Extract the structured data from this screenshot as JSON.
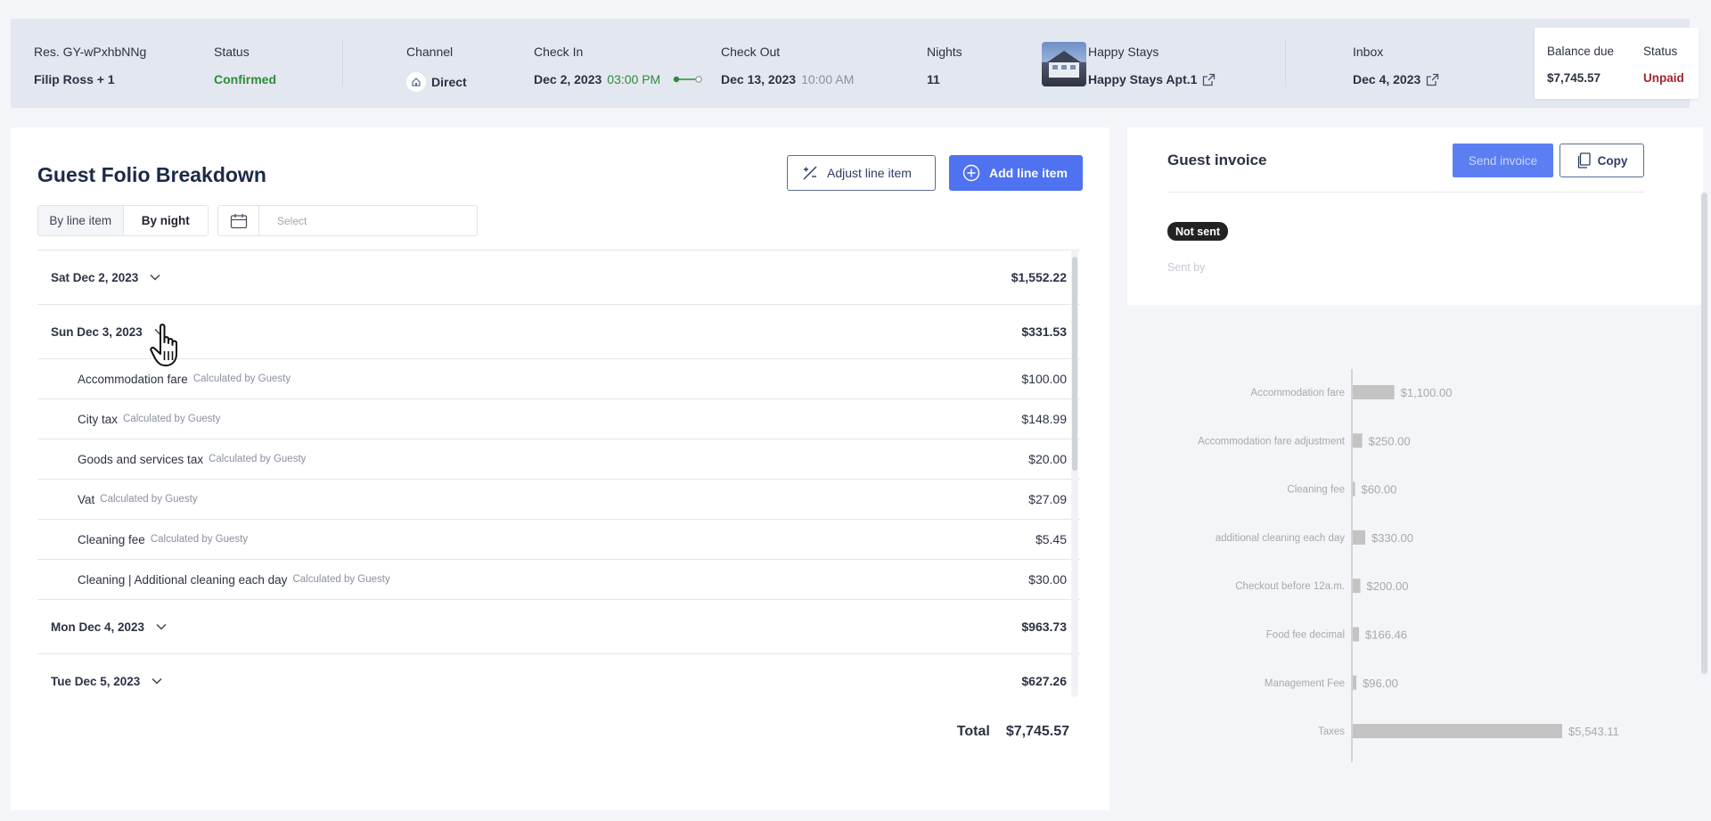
{
  "reservation": {
    "res_label": "Res. GY-wPxhbNNg",
    "guest": "Filip Ross + 1",
    "status_label": "Status",
    "status_value": "Confirmed",
    "channel_label": "Channel",
    "channel_value": "Direct",
    "checkin_label": "Check In",
    "checkin_date": "Dec 2, 2023",
    "checkin_time": "03:00 PM",
    "checkout_label": "Check Out",
    "checkout_date": "Dec 13, 2023",
    "checkout_time": "10:00 AM",
    "nights_label": "Nights",
    "nights_value": "11",
    "listing_label": "Happy Stays",
    "listing_value": "Happy Stays Apt.1",
    "inbox_label": "Inbox",
    "inbox_value": "Dec 4, 2023",
    "balance_label": "Balance due",
    "balance_value": "$7,745.57",
    "pay_status_label": "Status",
    "pay_status_value": "Unpaid"
  },
  "folio": {
    "title": "Guest Folio Breakdown",
    "adjust_label": "Adjust line item",
    "add_label": "Add line item",
    "toggle": [
      "By line item",
      "By night"
    ],
    "active_toggle": "By night",
    "date_placeholder": "Select",
    "rows": [
      {
        "type": "day",
        "label": "Sat Dec 2, 2023",
        "amount": "$1,552.22",
        "expanded": false
      },
      {
        "type": "day",
        "label": "Sun Dec 3, 2023",
        "amount": "$331.53",
        "expanded": true
      },
      {
        "type": "item",
        "label": "Accommodation fare",
        "note": "Calculated by Guesty",
        "amount": "$100.00"
      },
      {
        "type": "item",
        "label": "City tax",
        "note": "Calculated by Guesty",
        "amount": "$148.99"
      },
      {
        "type": "item",
        "label": "Goods and services tax",
        "note": "Calculated by Guesty",
        "amount": "$20.00"
      },
      {
        "type": "item",
        "label": "Vat",
        "note": "Calculated by Guesty",
        "amount": "$27.09"
      },
      {
        "type": "item",
        "label": "Cleaning fee",
        "note": "Calculated by Guesty",
        "amount": "$5.45"
      },
      {
        "type": "item",
        "label": "Cleaning | Additional cleaning each day",
        "note": "Calculated by Guesty",
        "amount": "$30.00"
      },
      {
        "type": "day",
        "label": "Mon Dec 4, 2023",
        "amount": "$963.73",
        "expanded": false
      },
      {
        "type": "day",
        "label": "Tue Dec 5, 2023",
        "amount": "$627.26",
        "expanded": false
      }
    ],
    "total_label": "Total",
    "total_value": "$7,745.57"
  },
  "invoice": {
    "title": "Guest invoice",
    "send_label": "Send invoice",
    "copy_label": "Copy",
    "badge": "Not sent",
    "sent_by_label": "Sent by"
  },
  "chart_data": {
    "type": "bar",
    "orientation": "horizontal",
    "categories": [
      "Accommodation fare",
      "Accommodation fare adjustment",
      "Cleaning fee",
      "additional cleaning each day",
      "Checkout before 12a.m.",
      "Food fee decimal",
      "Management Fee",
      "Taxes"
    ],
    "values": [
      1100.0,
      250.0,
      60.0,
      330.0,
      200.0,
      166.46,
      96.0,
      5543.11
    ],
    "value_labels": [
      "$1,100.00",
      "$250.00",
      "$60.00",
      "$330.00",
      "$200.00",
      "$166.46",
      "$96.00",
      "$5,543.11"
    ],
    "color": "#c3c3c3",
    "xlim": [
      0,
      5543.11
    ]
  },
  "colors": {
    "accent": "#4e72f0",
    "confirmed": "#2e8b3a",
    "unpaid": "#a2262a"
  }
}
